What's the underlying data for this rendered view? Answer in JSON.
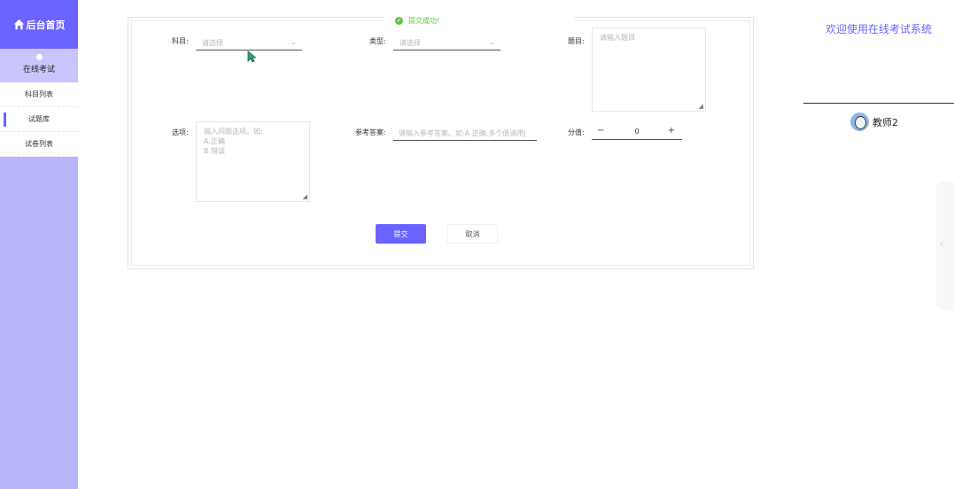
{
  "sidebar": {
    "brand": "后台首页",
    "group": "在线考试",
    "items": [
      {
        "label": "科目列表",
        "active": false
      },
      {
        "label": "试题库",
        "active": true
      },
      {
        "label": "试卷列表",
        "active": false
      }
    ]
  },
  "toast": {
    "message": "提交成功!"
  },
  "form": {
    "subject": {
      "label": "科目:",
      "placeholder": "请选择"
    },
    "type": {
      "label": "类型:",
      "placeholder": "请选择"
    },
    "question": {
      "label": "题目:",
      "placeholder": "请输入题目"
    },
    "options": {
      "label": "选项:",
      "placeholder": "输入问题选项。如:\nA.正确\nB.错误"
    },
    "answer": {
      "label": "参考答案:",
      "placeholder": "请输入参考答案。如:A 正确,多个值请用|"
    },
    "score": {
      "label": "分值:",
      "value": "0",
      "minus": "−",
      "plus": "+"
    },
    "submit_label": "提交",
    "cancel_label": "取消"
  },
  "header": {
    "welcome": "欢迎使用在线考试系统",
    "username": "教师2"
  },
  "colors": {
    "accent": "#6b63ff",
    "sidebar": "#b9b5fb",
    "success": "#67c23a"
  }
}
